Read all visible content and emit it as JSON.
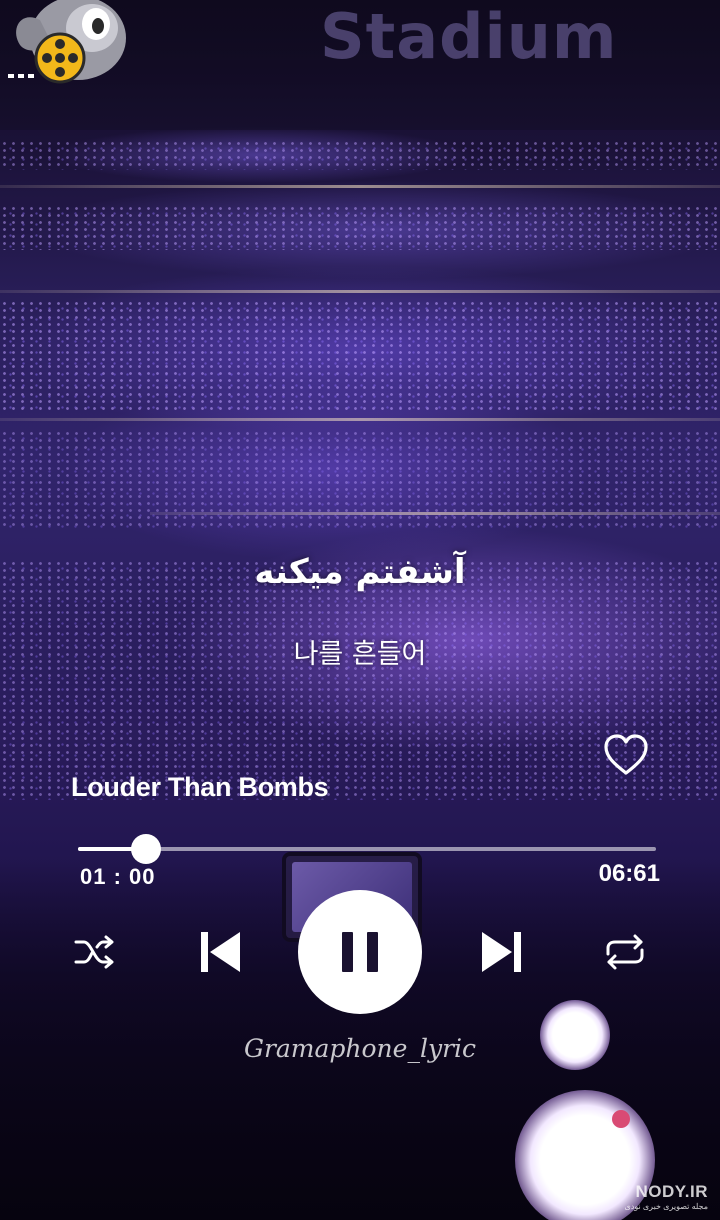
{
  "background": {
    "stadium_sign": "Stadium"
  },
  "lyrics": {
    "persian": "آشفتم میکنه",
    "korean": "나를 흔들어"
  },
  "player": {
    "song_title": "Louder Than Bombs",
    "time_current": "01 : 00",
    "time_total": "06:61",
    "progress_fraction": 0.118,
    "liked": false,
    "state": "playing"
  },
  "controls": {
    "shuffle_icon": "shuffle-icon",
    "previous_icon": "skip-previous-icon",
    "pause_icon": "pause-icon",
    "next_icon": "skip-next-icon",
    "repeat_icon": "repeat-icon",
    "like_icon": "heart-outline-icon"
  },
  "watermark": {
    "channel": "Gramaphone_lyric"
  },
  "site": {
    "name": "NODY.IR",
    "subtitle": "مجله تصویری خبری نودی"
  },
  "colors": {
    "accent": "#ffffff",
    "background_purple": "#2a1f5c",
    "glow_purple": "#a56eff"
  }
}
